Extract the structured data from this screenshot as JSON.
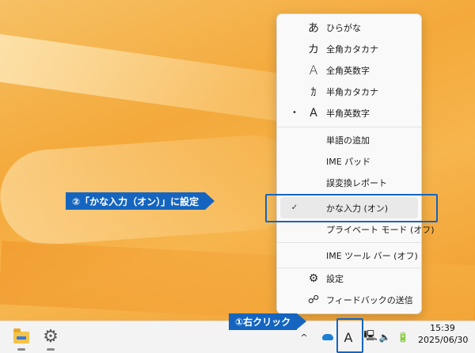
{
  "ime_menu": {
    "items": [
      {
        "id": "hiragana",
        "icon": "あ",
        "label": "ひらがな",
        "mark": ""
      },
      {
        "id": "zenkaku-katakana",
        "icon": "カ",
        "label": "全角カタカナ",
        "mark": ""
      },
      {
        "id": "zenkaku-eisu",
        "icon": "A",
        "label": "全角英数字",
        "mark": ""
      },
      {
        "id": "hankaku-katakana",
        "icon": "ｶ",
        "label": "半角カタカナ",
        "mark": ""
      },
      {
        "id": "hankaku-eisu",
        "icon": "A",
        "label": "半角英数字",
        "mark": "•"
      },
      {
        "id": "add-word",
        "icon": "",
        "label": "単語の追加",
        "mark": ""
      },
      {
        "id": "ime-pad",
        "icon": "",
        "label": "IME パッド",
        "mark": ""
      },
      {
        "id": "conversion-report",
        "icon": "",
        "label": "誤変換レポート",
        "mark": ""
      },
      {
        "id": "kana-input",
        "icon": "",
        "label": "かな入力 (オン)",
        "mark": "✓"
      },
      {
        "id": "private-mode",
        "icon": "",
        "label": "プライベート モード (オフ)",
        "mark": ""
      },
      {
        "id": "ime-toolbar",
        "icon": "",
        "label": "IME ツール バー (オフ)",
        "mark": ""
      },
      {
        "id": "settings",
        "icon": "⚙",
        "label": "設定",
        "mark": ""
      },
      {
        "id": "feedback",
        "icon": "☍",
        "label": "フィードバックの送信",
        "mark": ""
      }
    ]
  },
  "annotations": {
    "step1": "①右クリック",
    "step2": "②「かな入力（オン）」に設定"
  },
  "taskbar": {
    "ime_indicator": "A",
    "chevron": "^",
    "time": "15:39",
    "date": "2025/06/30"
  },
  "colors": {
    "accent": "#1565c0",
    "menu_bg": "#f9f9f9",
    "highlight": "#e9e9e9"
  }
}
